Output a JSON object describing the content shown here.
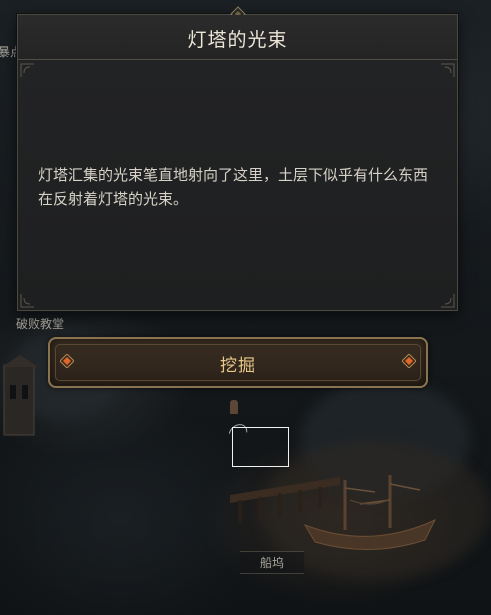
{
  "dialog": {
    "title": "灯塔的光束",
    "body": "灯塔汇集的光束笔直地射向了这里，土层下似乎有什么东西在反射着灯塔的光束。"
  },
  "action": {
    "dig_label": "挖掘"
  },
  "map": {
    "labels": {
      "top_left_partial": "暴点",
      "ruined_church": "破败教堂",
      "dock": "船坞"
    }
  },
  "colors": {
    "accent_gold": "#e9c98a",
    "gem_orange": "#e0662a",
    "frame": "#8a7450"
  }
}
